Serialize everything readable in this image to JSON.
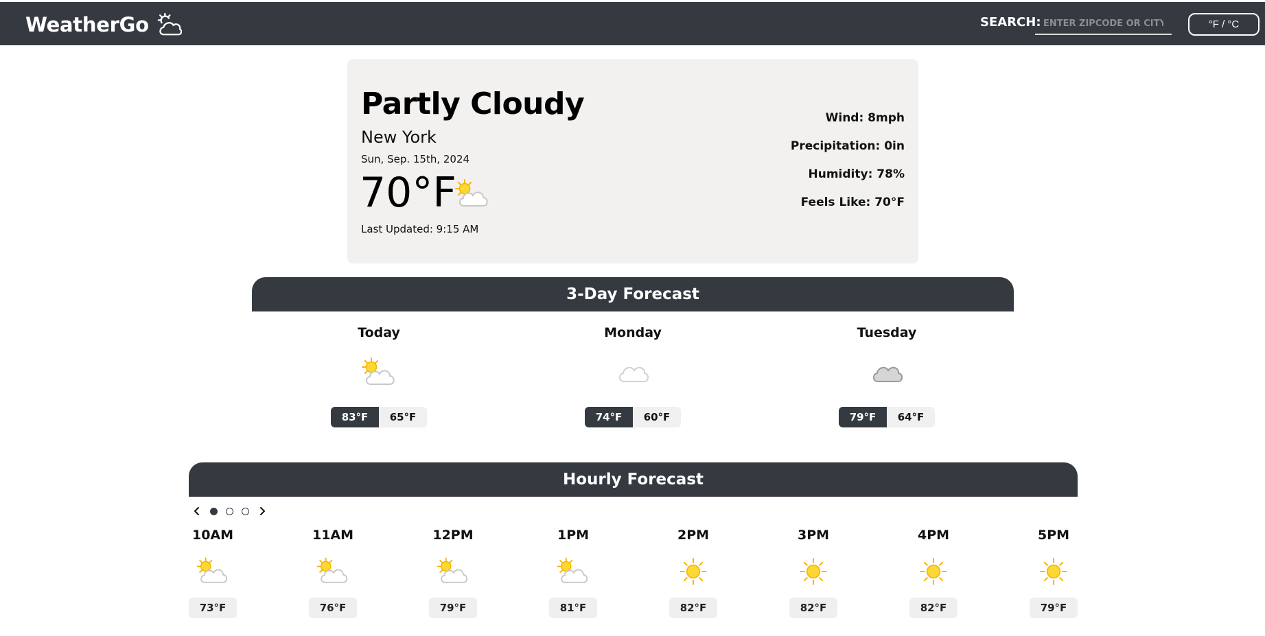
{
  "navbar": {
    "brand": "WeatherGo",
    "brand_icon": "sun-cloud-outline-icon",
    "search_label": "SEARCH:",
    "search_placeholder": "ENTER ZIPCODE OR CITY",
    "search_value": "",
    "unit_toggle": "°F / °C"
  },
  "current": {
    "condition": "Partly Cloudy",
    "city": "New York",
    "date": "Sun, Sep. 15th, 2024",
    "temp": "70°F",
    "icon": "partly-cloudy-icon",
    "last_updated": "Last Updated: 9:15 AM",
    "details": {
      "wind": "Wind: 8mph",
      "precipitation": "Precipitation: 0in",
      "humidity": "Humidity: 78%",
      "feels_like": "Feels Like: 70°F"
    }
  },
  "forecast_3day": {
    "title": "3-Day Forecast",
    "days": [
      {
        "name": "Today",
        "icon": "partly-cloudy-icon",
        "high": "83°F",
        "low": "65°F"
      },
      {
        "name": "Monday",
        "icon": "light-cloud-icon",
        "high": "74°F",
        "low": "60°F"
      },
      {
        "name": "Tuesday",
        "icon": "overcast-cloud-icon",
        "high": "79°F",
        "low": "64°F"
      }
    ]
  },
  "hourly": {
    "title": "Hourly Forecast",
    "carousel_pages": 3,
    "carousel_active": 1,
    "hours": [
      {
        "time": "10AM",
        "icon": "partly-cloudy-icon",
        "temp": "73°F"
      },
      {
        "time": "11AM",
        "icon": "partly-cloudy-icon",
        "temp": "76°F"
      },
      {
        "time": "12PM",
        "icon": "partly-cloudy-icon",
        "temp": "79°F"
      },
      {
        "time": "1PM",
        "icon": "partly-cloudy-icon",
        "temp": "81°F"
      },
      {
        "time": "2PM",
        "icon": "sunny-icon",
        "temp": "82°F"
      },
      {
        "time": "3PM",
        "icon": "sunny-icon",
        "temp": "82°F"
      },
      {
        "time": "4PM",
        "icon": "sunny-icon",
        "temp": "82°F"
      },
      {
        "time": "5PM",
        "icon": "sunny-icon",
        "temp": "79°F"
      }
    ]
  },
  "colors": {
    "navbar": "#343a40",
    "card_bg": "#f2f1f0",
    "sun": "#f7b500",
    "cloud_stroke": "#c8c8c8",
    "cloud_dark_fill": "#d6d6d6"
  }
}
